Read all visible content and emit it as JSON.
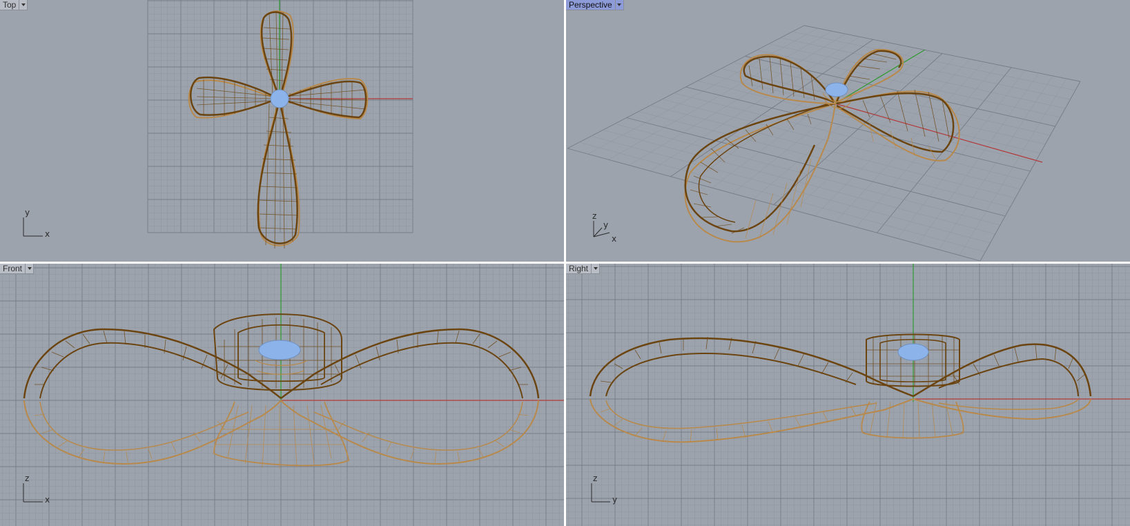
{
  "viewports": {
    "top": {
      "label": "Top",
      "axis_h": "x",
      "axis_v": "y"
    },
    "perspective": {
      "label": "Perspective",
      "axis_1": "z",
      "axis_2": "y",
      "axis_3": "x"
    },
    "front": {
      "label": "Front",
      "axis_h": "x",
      "axis_v": "z"
    },
    "right": {
      "label": "Right",
      "axis_h": "y",
      "axis_v": "z"
    }
  },
  "colors": {
    "viewport_bg": "#9ca3ad",
    "grid_minor": "#8e959f",
    "grid_major": "#767c86",
    "axis_x": "#b23a3a",
    "axis_y": "#2f9a2f",
    "wire_dark": "#6b4410",
    "wire_light": "#b8894a",
    "hub": "#8cb4ea",
    "active_tab": "#8d9bd8"
  },
  "icons": {
    "viewport_menu": "triangle-down-icon"
  }
}
